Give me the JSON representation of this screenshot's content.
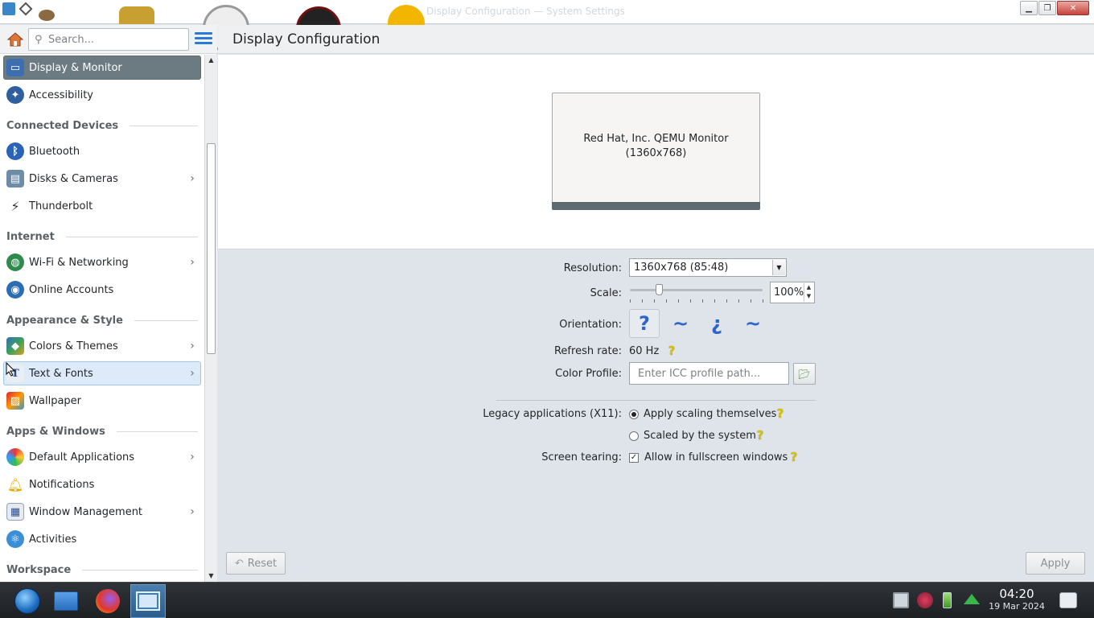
{
  "titlebar": {
    "watermark": "Display Configuration — System Settings"
  },
  "sidebar": {
    "search_placeholder": "Search...",
    "items": [
      {
        "label": "Display & Monitor",
        "icon": "monitor-icon",
        "active": true
      },
      {
        "label": "Accessibility",
        "icon": "accessibility-icon"
      },
      {
        "label": "Bluetooth",
        "icon": "bluetooth-icon"
      },
      {
        "label": "Disks & Cameras",
        "icon": "disks-icon",
        "chevron": true
      },
      {
        "label": "Thunderbolt",
        "icon": "thunderbolt-icon"
      },
      {
        "label": "Wi-Fi & Networking",
        "icon": "network-globe-icon",
        "chevron": true
      },
      {
        "label": "Online Accounts",
        "icon": "online-accounts-icon"
      },
      {
        "label": "Colors & Themes",
        "icon": "colors-icon",
        "chevron": true
      },
      {
        "label": "Text & Fonts",
        "icon": "fonts-icon",
        "chevron": true,
        "hover": true
      },
      {
        "label": "Wallpaper",
        "icon": "wallpaper-icon"
      },
      {
        "label": "Default Applications",
        "icon": "default-apps-icon",
        "chevron": true
      },
      {
        "label": "Notifications",
        "icon": "bell-icon"
      },
      {
        "label": "Window Management",
        "icon": "window-management-icon",
        "chevron": true
      },
      {
        "label": "Activities",
        "icon": "activities-icon"
      }
    ],
    "sections": [
      "Connected Devices",
      "Internet",
      "Appearance & Style",
      "Apps & Windows",
      "Workspace"
    ]
  },
  "main": {
    "title": "Display Configuration",
    "monitor": {
      "name": "Red Hat, Inc. QEMU Monitor",
      "resolution": "(1360x768)"
    },
    "resolution_label": "Resolution:",
    "resolution_value": "1360x768 (85:48)",
    "scale_label": "Scale:",
    "scale_value": "100%",
    "scale_slider_fraction": 0.22,
    "orientation_label": "Orientation:",
    "orientation_options": [
      "?",
      "~",
      "¿",
      "~"
    ],
    "refresh_label": "Refresh rate:",
    "refresh_value": "60 Hz",
    "color_profile_label": "Color Profile:",
    "color_profile_placeholder": "Enter ICC profile path...",
    "legacy_label": "Legacy applications (X11):",
    "legacy_opt1": "Apply scaling themselves",
    "legacy_opt2": "Scaled by the system",
    "tearing_label": "Screen tearing:",
    "tearing_opt": "Allow in fullscreen windows",
    "reset_label": "Reset",
    "apply_label": "Apply",
    "help_glyph": "?"
  },
  "taskbar": {
    "time": "04:20",
    "date": "19 Mar 2024"
  },
  "colors": {
    "accent": "#2c7bd2",
    "active_item": "#6c7a82",
    "hover_item": "#dceafa"
  }
}
